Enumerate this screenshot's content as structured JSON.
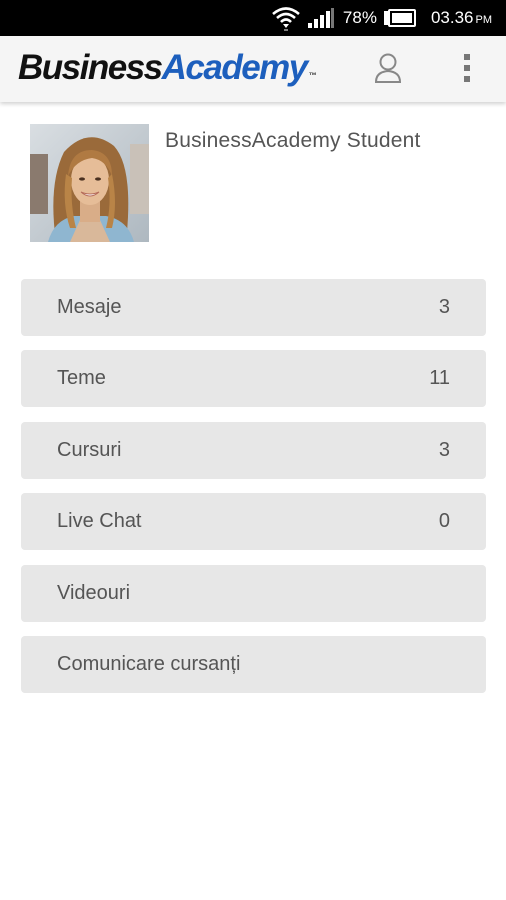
{
  "status_bar": {
    "battery_percent": "78%",
    "time": "03.36",
    "ampm": "PM"
  },
  "app_bar": {
    "logo_part1": "Business",
    "logo_part2": "Academy",
    "logo_tm": "™",
    "profile_icon": "person-outline-icon",
    "menu_icon": "overflow-menu-icon"
  },
  "profile": {
    "name": "BusinessAcademy Student"
  },
  "menu": {
    "items": [
      {
        "label": "Mesaje",
        "count": "3"
      },
      {
        "label": "Teme",
        "count": "11"
      },
      {
        "label": "Cursuri",
        "count": "3"
      },
      {
        "label": "Live Chat",
        "count": "0"
      },
      {
        "label": "Videouri",
        "count": ""
      },
      {
        "label": "Comunicare cursanți",
        "count": ""
      }
    ]
  },
  "colors": {
    "status_bar_bg": "#000000",
    "app_bar_bg": "#f5f5f5",
    "logo_dark": "#111111",
    "logo_blue": "#1d5fbd",
    "menu_item_bg": "#e7e7e7",
    "text_gray": "#555555"
  }
}
